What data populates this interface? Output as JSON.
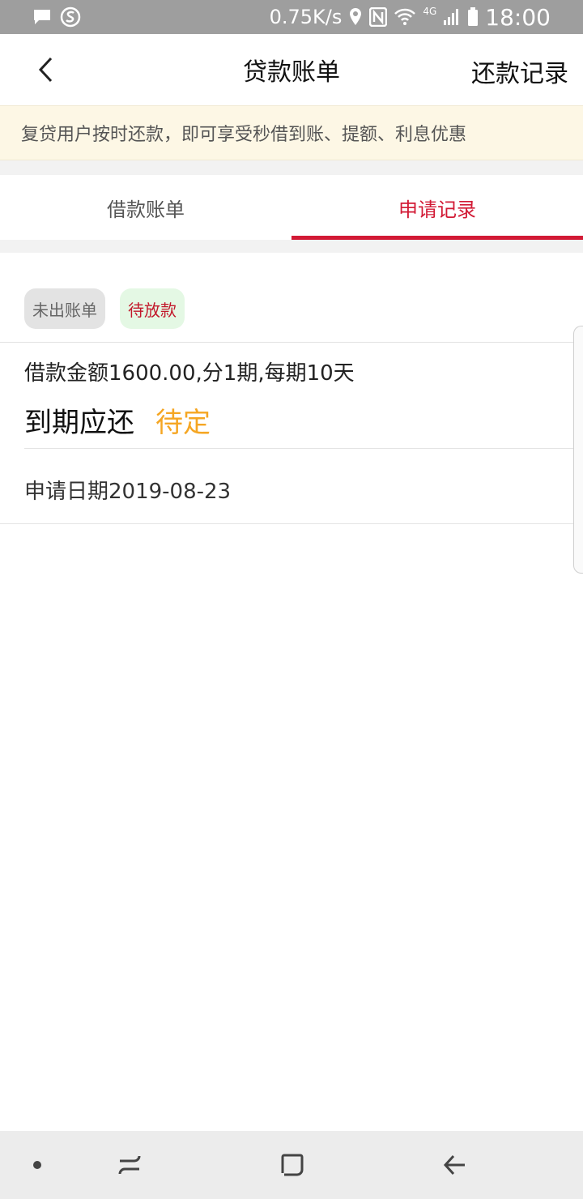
{
  "status_bar": {
    "speed": "0.75K/s",
    "network": "4G",
    "time": "18:00"
  },
  "header": {
    "title": "贷款账单",
    "action": "还款记录"
  },
  "notice": {
    "text": "复贷用户按时还款，即可享受秒借到账、提额、利息优惠"
  },
  "tabs": [
    {
      "label": "借款账单",
      "active": false
    },
    {
      "label": "申请记录",
      "active": true
    }
  ],
  "record": {
    "badges": [
      "未出账单",
      "待放款"
    ],
    "loan_info": "借款金额1600.00,分1期,每期10天",
    "due_label": "到期应还",
    "due_value": "待定",
    "apply_date": "申请日期2019-08-23"
  },
  "colors": {
    "accent": "#d21a35",
    "pending": "#f5a623",
    "notice_bg": "#fdf7e5"
  }
}
